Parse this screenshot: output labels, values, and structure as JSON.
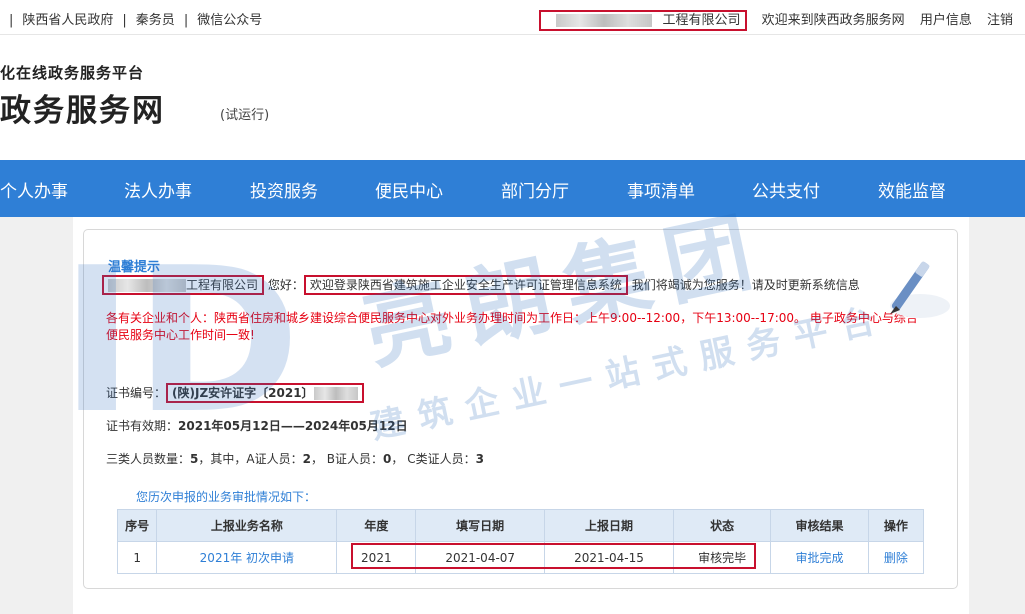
{
  "topbar": {
    "links": [
      "陕西省人民政府",
      "秦务员",
      "微信公众号"
    ],
    "company_suffix": "工程有限公司",
    "welcome": "欢迎来到陕西政务服务网",
    "user_info": "用户信息",
    "logout": "注销"
  },
  "header": {
    "subtitle": "化在线政务服务平台",
    "title": "政务服务网",
    "trial": "(试运行)"
  },
  "nav": {
    "items": [
      "个人办事",
      "法人办事",
      "投资服务",
      "便民中心",
      "部门分厅",
      "事项清单",
      "公共支付",
      "效能监督"
    ]
  },
  "panel": {
    "tip_title": "温馨提示",
    "company_suffix": "工程有限公司",
    "greeting": "您好：",
    "system_welcome": "欢迎登录陕西省建筑施工企业安全生产许可证管理信息系统",
    "service_msg": "我们将竭诚为您服务！请及时更新系统信息",
    "notice": "各有关企业和个人：陕西省住房和城乡建设综合便民服务中心对外业务办理时间为工作日：上午9:00--12:00，下午13:00--17:00。 电子政务中心与综合便民服务中心工作时间一致!",
    "cert_label": "证书编号：",
    "cert_value": "(陕)JZ安许证字〔2021〕",
    "valid_label": "证书有效期：",
    "valid_value": "2021年05月12日——2024年05月12日",
    "staff_label": "三类人员数量：",
    "staff_total": "5",
    "staff_mid": "，其中，A证人员：",
    "staff_a": "2",
    "staff_b_label": "， B证人员：",
    "staff_b": "0",
    "staff_c_label": "， C类证人员：",
    "staff_c": "3",
    "history": "您历次申报的业务审批情况如下："
  },
  "table": {
    "headers": [
      "序号",
      "上报业务名称",
      "年度",
      "填写日期",
      "上报日期",
      "状态",
      "审核结果",
      "操作"
    ],
    "row": {
      "index": "1",
      "name": "2021年 初次申请",
      "year": "2021",
      "fill_date": "2021-04-07",
      "report_date": "2021-04-15",
      "status": "审核完毕",
      "result": "审批完成",
      "action": "删除"
    }
  },
  "watermark": {
    "title": "亮朗集团",
    "subtitle": "建筑企业一站式服务平台"
  },
  "colors": {
    "nav_blue": "#2f7fd6",
    "highlight_red": "#c8102e",
    "notice_red": "#e60012"
  }
}
